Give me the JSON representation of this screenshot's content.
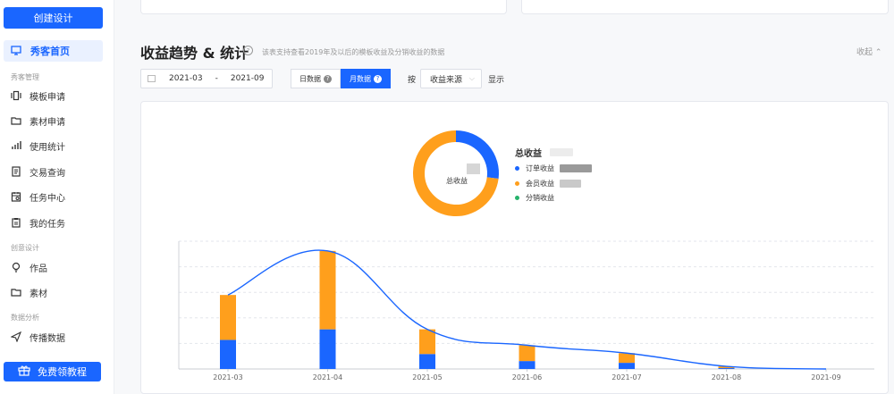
{
  "sidebar": {
    "create_label": "创建设计",
    "home_label": "秀客首页",
    "sections": [
      {
        "label": "秀客管理"
      },
      {
        "label": "创意设计"
      },
      {
        "label": "数据分析"
      }
    ],
    "items": [
      {
        "label": "模板申请",
        "icon": "template-icon"
      },
      {
        "label": "素材申请",
        "icon": "folder-icon"
      },
      {
        "label": "使用统计",
        "icon": "bar-chart-icon"
      },
      {
        "label": "交易查询",
        "icon": "document-icon"
      },
      {
        "label": "任务中心",
        "icon": "task-calendar-icon"
      },
      {
        "label": "我的任务",
        "icon": "clipboard-icon"
      },
      {
        "label": "作品",
        "icon": "bulb-icon"
      },
      {
        "label": "素材",
        "icon": "folder-icon"
      },
      {
        "label": "传播数据",
        "icon": "send-icon"
      }
    ],
    "tutorial_label": "免费领教程"
  },
  "header": {
    "title": "收益趋势 & 统计",
    "subtitle": "该表支持查看2019年及以后的模板收益及分销收益的数据",
    "collapse_label": "收起"
  },
  "filters": {
    "start": "2021-03",
    "separator": "-",
    "end": "2021-09",
    "day_label": "日数据",
    "month_label": "月数据",
    "by_label": "按",
    "select_value": "收益来源",
    "show_label": "显示"
  },
  "donut": {
    "center_label": "总收益",
    "legend_title": "总收益",
    "legend": [
      {
        "name": "订单收益",
        "color": "#1a66ff"
      },
      {
        "name": "会员收益",
        "color": "#ff9f1c"
      },
      {
        "name": "分销收益",
        "color": "#26b26b"
      }
    ]
  },
  "chart_data": [
    {
      "type": "pie",
      "categories": [
        "订单收益",
        "会员收益",
        "分销收益"
      ],
      "values": [
        27,
        73,
        0
      ],
      "colors": [
        "#1a66ff",
        "#ff9f1c",
        "#26b26b"
      ]
    },
    {
      "type": "bar",
      "categories": [
        "2021-03",
        "2021-04",
        "2021-05",
        "2021-06",
        "2021-07",
        "2021-08",
        "2021-09"
      ],
      "series": [
        {
          "name": "订单收益",
          "color": "#1a66ff",
          "values": [
            33,
            45,
            17,
            9,
            7,
            1,
            0
          ]
        },
        {
          "name": "会员收益",
          "color": "#ff9f1c",
          "values": [
            51,
            89,
            28,
            18,
            11,
            2,
            0
          ]
        }
      ],
      "line": {
        "color": "#1a66ff",
        "values": [
          84,
          134,
          45,
          27,
          18,
          3,
          0
        ]
      },
      "ylim": [
        0,
        145
      ],
      "grid": true
    }
  ]
}
